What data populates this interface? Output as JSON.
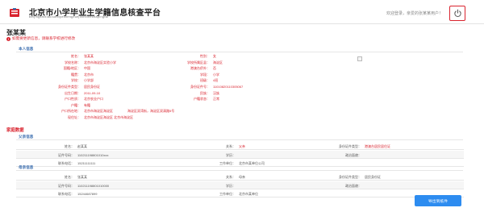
{
  "header": {
    "title": "北京市小学毕业生学籍信息核查平台",
    "subtitle": "Beijingshixiaoxuebiyeshengxuejixinxihechapingtai",
    "welcome": "欢迎登录，亲爱的张某某用户！",
    "logout_icon": "power-icon"
  },
  "student": {
    "name": "张某某",
    "notice": "如需要更新信息，请联系学校进行修改"
  },
  "basic": {
    "section_title": "本人信息",
    "rows": [
      {
        "l1": "姓名：",
        "v1": "张某某",
        "l2": "性别：",
        "v2": "女"
      },
      {
        "l1": "学校名称：",
        "v1": "北京市海淀区实验小学",
        "l2": "学校所属区县：",
        "v2": "海淀区"
      },
      {
        "l1": "国籍/地区：",
        "v1": "中国",
        "l2": "港澳台侨外：",
        "v2": "否"
      },
      {
        "l1": "籍贯：",
        "v1": "北京市",
        "l2": "学段：",
        "v2": "小学"
      },
      {
        "l1": "学校：",
        "v1": "小学部",
        "l2": "班级：",
        "v2": "4班"
      },
      {
        "l1": "身份证件类型：",
        "v1": "居民身份证",
        "l2": "身份证件号：",
        "v2": "11010820110305067"
      },
      {
        "l1": "出生日期：",
        "v1": "2011-09-10",
        "l2": "民族：",
        "v2": "汉族"
      },
      {
        "l1": "户口性质：",
        "v1": "北京农业户口",
        "l2": "户籍状态：",
        "v2": "正常"
      },
      {
        "l1": "户籍：",
        "v1": "有籍"
      },
      {
        "l1": "户口所在地：",
        "v1": "北京市海淀区海淀区",
        "v1b": "海淀区双湾街，海淀区双清路5号"
      },
      {
        "l1": "现住址：",
        "v1": "北京市海淀区海淀区 北京市海淀区"
      }
    ]
  },
  "family": {
    "title": "家庭数据",
    "father": {
      "section_title": "父亲信息",
      "rows": [
        {
          "l1": "姓名：",
          "v1": "赵某某",
          "l2": "关系：",
          "v2": "父亲",
          "l3": "身份证件类型：",
          "v3": "港澳台居民居住证"
        },
        {
          "l1": "证件号码：",
          "v1": "110211198801010xxx",
          "l2": "学历：",
          "v2": "",
          "l3": "政治面貌：",
          "v3": ""
        },
        {
          "l1": "联系电话：",
          "v1": "15211111111",
          "l2": "工作单位：",
          "v2": "北京市某单位公司",
          "l3": "",
          "v3": ""
        }
      ]
    },
    "mother": {
      "section_title": "母亲信息",
      "rows": [
        {
          "l1": "姓名：",
          "v1": "张某某",
          "l2": "关系：",
          "v2": "母亲",
          "l3": "身份证件类型：",
          "v3": "居民身份证"
        },
        {
          "l1": "证件号码：",
          "v1": "110211198801010000",
          "l2": "学历：",
          "v2": "",
          "l3": "政治面貌：",
          "v3": ""
        },
        {
          "l1": "联系电话：",
          "v1": "15244687899",
          "l2": "工作单位：",
          "v2": "北京市某单位",
          "l3": "",
          "v3": ""
        }
      ]
    }
  },
  "footer": {
    "export_label": "导出到纸件"
  },
  "colors": {
    "accent_red": "#d9232e",
    "section_blue": "#3d6fb0",
    "button_blue": "#2d8cf0"
  }
}
